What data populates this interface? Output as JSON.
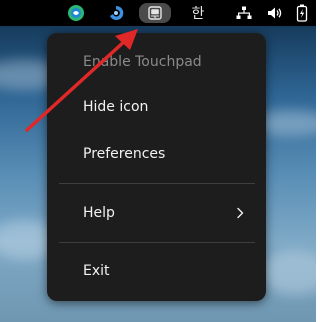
{
  "colors": {
    "topbar_bg": "#000000",
    "menu_bg": "#1d1d1d",
    "menu_text": "#f2f2f2",
    "menu_text_disabled": "#8a8a8a",
    "separator": "#3e3e3e",
    "annotation_arrow": "#e02828",
    "active_tray_bg": "#4a4a4a"
  },
  "topbar": {
    "tray_icons": [
      {
        "icon": "green-circle-app-icon"
      },
      {
        "icon": "blue-swirl-app-icon"
      },
      {
        "icon": "touchpad-icon",
        "active": true
      },
      {
        "icon": "hangul-input-icon",
        "label": "한"
      },
      {
        "icon": "network-wired-icon"
      },
      {
        "icon": "volume-icon"
      },
      {
        "icon": "battery-charging-icon"
      }
    ]
  },
  "menu": {
    "items": [
      {
        "label": "Enable Touchpad",
        "enabled": false
      },
      {
        "label": "Hide icon",
        "enabled": true
      },
      {
        "label": "Preferences",
        "enabled": true
      },
      {
        "label": "Help",
        "enabled": true,
        "submenu": true,
        "submenu_icon": "chevron-right-icon"
      },
      {
        "label": "Exit",
        "enabled": true
      }
    ]
  }
}
